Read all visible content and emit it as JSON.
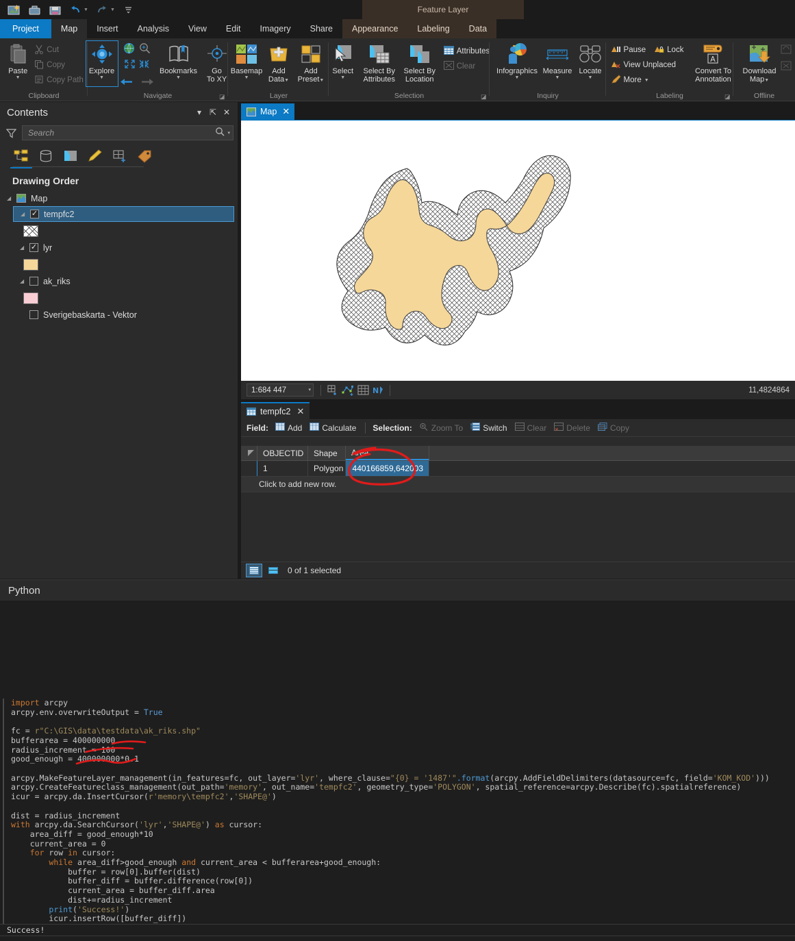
{
  "quick_access": {
    "items": [
      {
        "name": "new-project-icon",
        "label": "New Project"
      },
      {
        "name": "open-project-icon",
        "label": "Open Project"
      },
      {
        "name": "save-project-icon",
        "label": "Save Project"
      },
      {
        "name": "undo-icon",
        "label": "Undo"
      },
      {
        "name": "redo-icon",
        "label": "Redo"
      },
      {
        "name": "customize-quick-access-icon",
        "label": "Customize Quick Access Toolbar"
      }
    ]
  },
  "contextual_tab_group": {
    "title": "Feature Layer"
  },
  "tabs": [
    {
      "label": "Project",
      "state": "project"
    },
    {
      "label": "Map",
      "state": "active"
    },
    {
      "label": "Insert",
      "state": "normal"
    },
    {
      "label": "Analysis",
      "state": "normal"
    },
    {
      "label": "View",
      "state": "normal"
    },
    {
      "label": "Edit",
      "state": "normal"
    },
    {
      "label": "Imagery",
      "state": "normal"
    },
    {
      "label": "Share",
      "state": "normal"
    },
    {
      "label": "Appearance",
      "state": "contextual"
    },
    {
      "label": "Labeling",
      "state": "contextual"
    },
    {
      "label": "Data",
      "state": "contextual"
    }
  ],
  "ribbon": {
    "groups": [
      {
        "name": "clipboard",
        "title": "Clipboard",
        "paste_label": "Paste",
        "items": [
          {
            "label": "Cut",
            "icon": "cut-icon",
            "disabled": true
          },
          {
            "label": "Copy",
            "icon": "copy-icon",
            "disabled": true
          },
          {
            "label": "Copy Path",
            "icon": "copy-path-icon",
            "disabled": true
          }
        ]
      },
      {
        "name": "navigate",
        "title": "Navigate",
        "explore_label": "Explore",
        "bookmarks_label": "Bookmarks",
        "goto_label": "Go\nTo XY",
        "goto_line1": "Go",
        "goto_line2": "To XY"
      },
      {
        "name": "layer",
        "title": "Layer",
        "basemap_label": "Basemap",
        "add_data_line1": "Add",
        "add_data_line2": "Data",
        "add_preset_line1": "Add",
        "add_preset_line2": "Preset"
      },
      {
        "name": "selection",
        "title": "Selection",
        "select_label": "Select",
        "select_by_attributes_line1": "Select By",
        "select_by_attributes_line2": "Attributes",
        "select_by_location_line1": "Select By",
        "select_by_location_line2": "Location",
        "attributes_label": "Attributes",
        "clear_label": "Clear"
      },
      {
        "name": "inquiry",
        "title": "Inquiry",
        "infographics_label": "Infographics",
        "measure_label": "Measure",
        "locate_label": "Locate"
      },
      {
        "name": "labeling",
        "title": "Labeling",
        "pause_label": "Pause",
        "lock_label": "Lock",
        "view_unplaced_label": "View Unplaced",
        "more_label": "More",
        "convert_line1": "Convert To",
        "convert_line2": "Annotation"
      },
      {
        "name": "offline",
        "title": "Offline",
        "download_line1": "Download",
        "download_line2": "Map"
      }
    ]
  },
  "contents_pane": {
    "title": "Contents",
    "search": {
      "placeholder": "Search"
    },
    "list_tabs": [
      {
        "name": "drawing-order-tab",
        "label": "List By Drawing Order",
        "selected": true
      },
      {
        "name": "data-source-tab",
        "label": "List By Data Source",
        "selected": false
      },
      {
        "name": "selection-tab",
        "label": "List By Selection",
        "selected": false
      },
      {
        "name": "editing-tab",
        "label": "List By Editing",
        "selected": false
      },
      {
        "name": "snapping-tab",
        "label": "List By Snapping",
        "selected": false
      },
      {
        "name": "labeling-tab",
        "label": "List By Labeling",
        "selected": false
      }
    ],
    "section_title": "Drawing Order",
    "tree": [
      {
        "label": "Map",
        "type": "map",
        "indent": 0,
        "expander": true
      },
      {
        "label": "tempfc2",
        "type": "layer",
        "indent": 1,
        "checked": true,
        "selected": true,
        "expander": true,
        "symbol": {
          "kind": "hatch",
          "color": "#ffffff"
        }
      },
      {
        "label": "lyr",
        "type": "layer",
        "indent": 1,
        "checked": true,
        "selected": false,
        "expander": true,
        "symbol": {
          "kind": "fill",
          "color": "#f5d79a"
        }
      },
      {
        "label": "ak_riks",
        "type": "layer",
        "indent": 1,
        "checked": false,
        "selected": false,
        "expander": true,
        "symbol": {
          "kind": "fill",
          "color": "#f9cdd4"
        }
      },
      {
        "label": "Sverigebaskarta - Vektor",
        "type": "layer",
        "indent": 1,
        "checked": false,
        "selected": false,
        "expander": false
      }
    ]
  },
  "map_view": {
    "tab_label": "Map",
    "scale": "1:684 447",
    "coordinates": "11,4824864",
    "tools": [
      {
        "name": "add-grid-icon",
        "label": "Add Grid"
      },
      {
        "name": "edit-vertices-icon",
        "label": "Edit Vertices"
      },
      {
        "name": "grid-icon",
        "label": "Grid"
      },
      {
        "name": "north-arrow-icon",
        "label": "North"
      }
    ],
    "polygon_fill": "#f5d79a",
    "background": "#ffffff"
  },
  "attribute_table": {
    "tab_label": "tempfc2",
    "toolbar": {
      "field_label": "Field:",
      "add_label": "Add",
      "calculate_label": "Calculate",
      "selection_label": "Selection:",
      "zoom_to_label": "Zoom To",
      "switch_label": "Switch",
      "clear_label": "Clear",
      "delete_label": "Delete",
      "copy_label": "Copy"
    },
    "columns": [
      "OBJECTID",
      "Shape",
      "Area"
    ],
    "rows": [
      {
        "OBJECTID": "1",
        "Shape": "Polygon",
        "Area": "440166859,642003"
      }
    ],
    "add_row_text": "Click to add new row.",
    "status": "0 of 1 selected"
  },
  "python_pane": {
    "title": "Python",
    "code_lines": [
      [
        {
          "t": "import ",
          "c": "kw"
        },
        {
          "t": "arcpy",
          "c": "plain"
        }
      ],
      [
        {
          "t": "arcpy.env.overwriteOutput ",
          "c": "plain"
        },
        {
          "t": "= ",
          "c": "plain"
        },
        {
          "t": "True",
          "c": "const"
        }
      ],
      [],
      [
        {
          "t": "fc = ",
          "c": "plain"
        },
        {
          "t": "r\"C:\\GIS\\data\\testdata\\ak_riks.shp\"",
          "c": "str"
        }
      ],
      [
        {
          "t": "bufferarea = ",
          "c": "plain"
        },
        {
          "t": "400000000",
          "c": "num"
        }
      ],
      [
        {
          "t": "radius_increment = ",
          "c": "plain"
        },
        {
          "t": "100",
          "c": "num"
        }
      ],
      [
        {
          "t": "good_enough = ",
          "c": "plain"
        },
        {
          "t": "400000000*0.1",
          "c": "num"
        }
      ],
      [],
      [
        {
          "t": "arcpy.",
          "c": "plain"
        },
        {
          "t": "MakeFeatureLayer_management",
          "c": "plain"
        },
        {
          "t": "(in_features=fc, out_layer=",
          "c": "plain"
        },
        {
          "t": "'lyr'",
          "c": "str"
        },
        {
          "t": ", where_clause=",
          "c": "plain"
        },
        {
          "t": "\"{0} = '1487'\"",
          "c": "str"
        },
        {
          "t": ".format",
          "c": "fn"
        },
        {
          "t": "(arcpy.AddFieldDelimiters(datasource=fc, field=",
          "c": "plain"
        },
        {
          "t": "'KOM_KOD'",
          "c": "str"
        },
        {
          "t": ")))",
          "c": "plain"
        }
      ],
      [
        {
          "t": "arcpy.",
          "c": "plain"
        },
        {
          "t": "CreateFeatureclass_management",
          "c": "plain"
        },
        {
          "t": "(out_path=",
          "c": "plain"
        },
        {
          "t": "'memory'",
          "c": "str"
        },
        {
          "t": ", out_name=",
          "c": "plain"
        },
        {
          "t": "'tempfc2'",
          "c": "str"
        },
        {
          "t": ", geometry_type=",
          "c": "plain"
        },
        {
          "t": "'POLYGON'",
          "c": "str"
        },
        {
          "t": ", spatial_reference=arcpy.Describe(fc).spatialreference)",
          "c": "plain"
        }
      ],
      [
        {
          "t": "icur = arcpy.da.InsertCursor(",
          "c": "plain"
        },
        {
          "t": "r'memory\\tempfc2'",
          "c": "str"
        },
        {
          "t": ",",
          "c": "plain"
        },
        {
          "t": "'SHAPE@'",
          "c": "str"
        },
        {
          "t": ")",
          "c": "plain"
        }
      ],
      [],
      [
        {
          "t": "dist = radius_increment",
          "c": "plain"
        }
      ],
      [
        {
          "t": "with ",
          "c": "kw"
        },
        {
          "t": "arcpy.da.SearchCursor(",
          "c": "plain"
        },
        {
          "t": "'lyr'",
          "c": "str"
        },
        {
          "t": ",",
          "c": "plain"
        },
        {
          "t": "'SHAPE@'",
          "c": "str"
        },
        {
          "t": ") ",
          "c": "plain"
        },
        {
          "t": "as ",
          "c": "kw"
        },
        {
          "t": "cursor:",
          "c": "plain"
        }
      ],
      [
        {
          "t": "    area_diff = good_enough*10",
          "c": "plain"
        }
      ],
      [
        {
          "t": "    current_area = 0",
          "c": "plain"
        }
      ],
      [
        {
          "t": "    ",
          "c": "plain"
        },
        {
          "t": "for ",
          "c": "kw"
        },
        {
          "t": "row ",
          "c": "plain"
        },
        {
          "t": "in ",
          "c": "kw"
        },
        {
          "t": "cursor:",
          "c": "plain"
        }
      ],
      [
        {
          "t": "        ",
          "c": "plain"
        },
        {
          "t": "while ",
          "c": "kw"
        },
        {
          "t": "area_diff>good_enough ",
          "c": "plain"
        },
        {
          "t": "and ",
          "c": "kw"
        },
        {
          "t": "current_area < bufferarea+good_enough:",
          "c": "plain"
        }
      ],
      [
        {
          "t": "            buffer = row[0].buffer(dist)",
          "c": "plain"
        }
      ],
      [
        {
          "t": "            buffer_diff = buffer.difference(row[0])",
          "c": "plain"
        }
      ],
      [
        {
          "t": "            current_area = buffer_diff.area",
          "c": "plain"
        }
      ],
      [
        {
          "t": "            dist+=radius_increment",
          "c": "plain"
        }
      ],
      [
        {
          "t": "        ",
          "c": "plain"
        },
        {
          "t": "print",
          "c": "fn"
        },
        {
          "t": "(",
          "c": "plain"
        },
        {
          "t": "'Success!'",
          "c": "str"
        },
        {
          "t": ")",
          "c": "plain"
        }
      ],
      [
        {
          "t": "        icur.insertRow([buffer_diff])",
          "c": "plain"
        }
      ]
    ],
    "output": "Success!"
  },
  "annotations": {
    "ellipse_target": "440166859,642003",
    "underline_1": "400000000",
    "underline_2": "100",
    "underline_3": "400000000*0.1",
    "color": "#e01b1b"
  }
}
